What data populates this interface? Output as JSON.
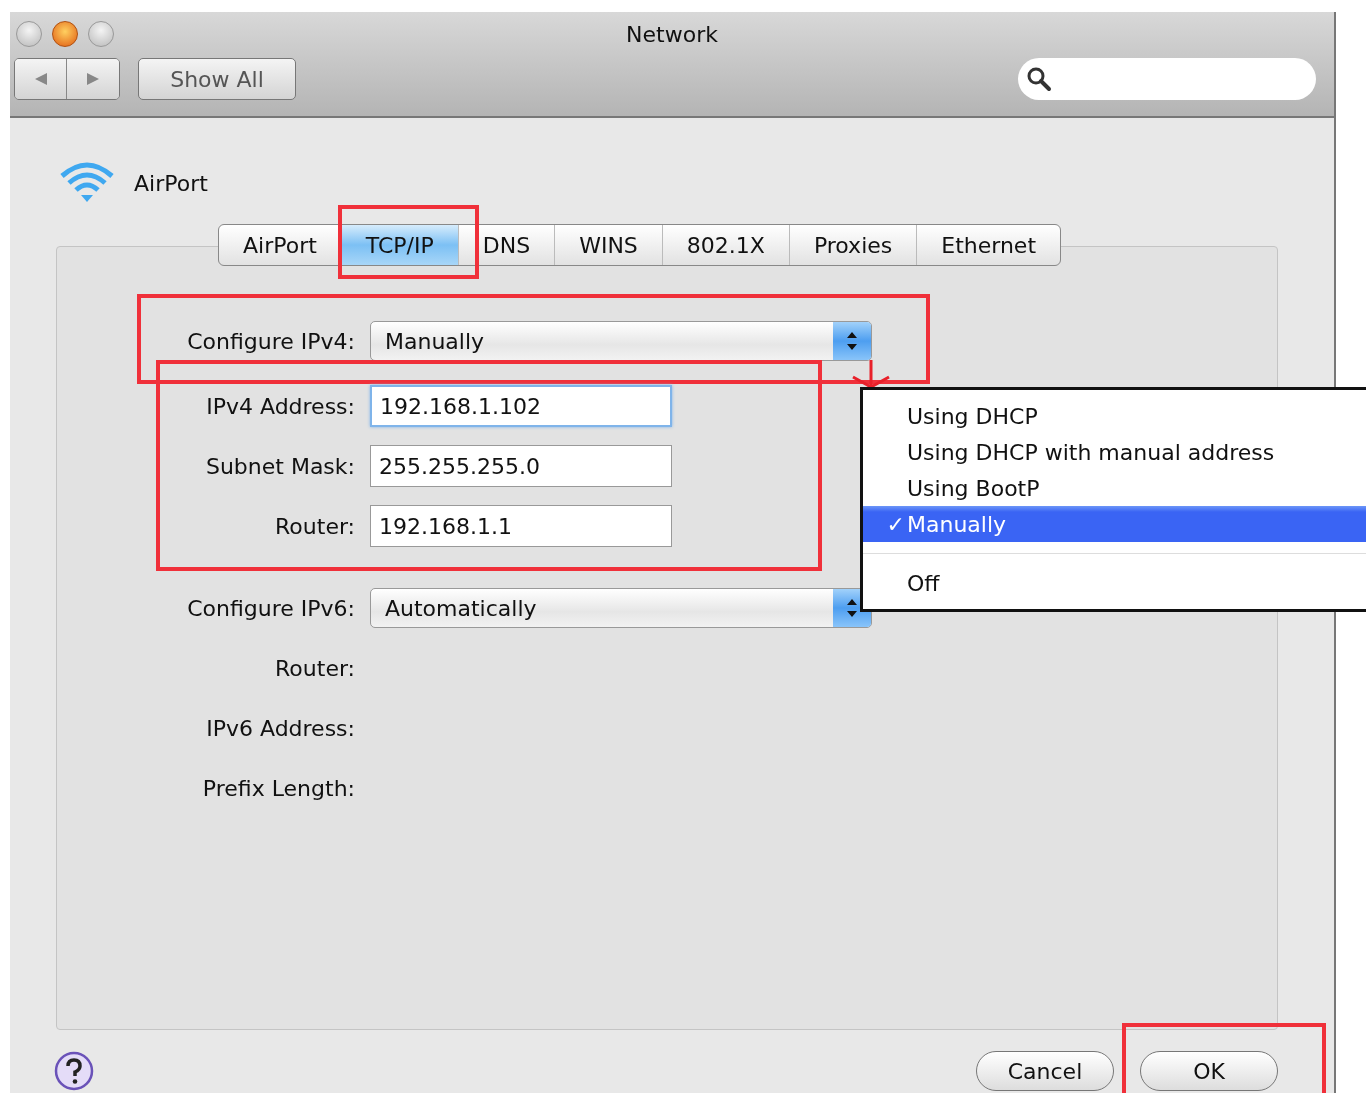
{
  "window": {
    "title": "Network"
  },
  "toolbar": {
    "show_all": "Show All"
  },
  "service": {
    "name": "AirPort"
  },
  "tabs": [
    {
      "label": "AirPort",
      "selected": false,
      "highlighted": false
    },
    {
      "label": "TCP/IP",
      "selected": true,
      "highlighted": true
    },
    {
      "label": "DNS",
      "selected": false,
      "highlighted": false
    },
    {
      "label": "WINS",
      "selected": false,
      "highlighted": false
    },
    {
      "label": "802.1X",
      "selected": false,
      "highlighted": false
    },
    {
      "label": "Proxies",
      "selected": false,
      "highlighted": false
    },
    {
      "label": "Ethernet",
      "selected": false,
      "highlighted": false
    }
  ],
  "ipv4": {
    "configure": {
      "label": "Configure IPv4:",
      "value": "Manually",
      "highlighted": true
    },
    "highlighted": true,
    "fields": [
      {
        "label": "IPv4 Address:",
        "value": "192.168.1.102",
        "focused": true
      },
      {
        "label": "Subnet Mask:",
        "value": "255.255.255.0",
        "focused": false
      },
      {
        "label": "Router:",
        "value": "192.168.1.1",
        "focused": false
      }
    ]
  },
  "ipv6": {
    "configure": {
      "label": "Configure IPv6:",
      "value": "Automatically"
    },
    "fields": [
      {
        "label": "Router:"
      },
      {
        "label": "IPv6 Address:"
      },
      {
        "label": "Prefix Length:"
      }
    ]
  },
  "popup_menu": {
    "check_mark": "✓",
    "items": [
      {
        "kind": "item",
        "label": "Using DHCP",
        "selected": false
      },
      {
        "kind": "item",
        "label": "Using DHCP with manual address",
        "selected": false
      },
      {
        "kind": "item",
        "label": "Using BootP",
        "selected": false
      },
      {
        "kind": "item",
        "label": "Manually",
        "selected": true
      },
      {
        "kind": "separator"
      },
      {
        "kind": "item",
        "label": "Off",
        "selected": false
      }
    ]
  },
  "buttons": [
    {
      "label": "Cancel",
      "highlighted": false
    },
    {
      "label": "OK",
      "highlighted": true
    }
  ]
}
